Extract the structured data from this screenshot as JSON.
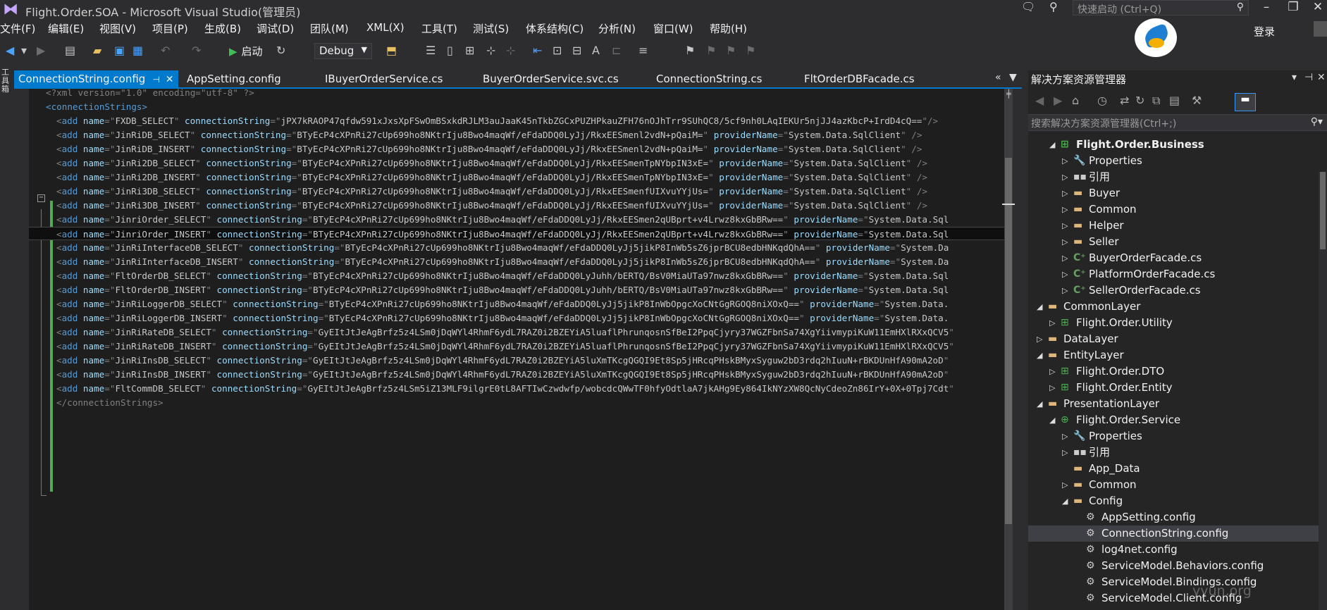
{
  "window": {
    "title": "Flight.Order.SOA - Microsoft Visual Studio(管理员)",
    "quick_launch_placeholder": "快速启动 (Ctrl+Q)",
    "login_label": "登录"
  },
  "menu": [
    "文件(F)",
    "编辑(E)",
    "视图(V)",
    "项目(P)",
    "生成(B)",
    "调试(D)",
    "团队(M)",
    "XML(X)",
    "工具(T)",
    "测试(S)",
    "体系结构(C)",
    "分析(N)",
    "窗口(W)",
    "帮助(H)"
  ],
  "toolbar": {
    "start_label": "启动",
    "configuration": "Debug"
  },
  "left_toolbox_label": "工具箱",
  "tabs": [
    {
      "label": "ConnectionString.config",
      "active": true
    },
    {
      "label": "AppSetting.config",
      "active": false
    },
    {
      "label": "IBuyerOrderService.cs",
      "active": false
    },
    {
      "label": "BuyerOrderService.svc.cs",
      "active": false
    },
    {
      "label": "ConnectionString.cs",
      "active": false
    },
    {
      "label": "FltOrderDBFacade.cs",
      "active": false
    }
  ],
  "editor": {
    "xml_decl": "<?xml version=\"1.0\" encoding=\"utf-8\" ?>",
    "open_tag": "<connectionStrings>",
    "close_tag": "</connectionStrings>",
    "entries": [
      {
        "name": "FXDB_SELECT",
        "conn": "jPX7kRAOP47qfdw591xJxsXpFSwOmBSxkdRJLM3auJaaK45nTkbZGCxPUZHPkauZFH76nOJhTrr9SUhQC8/5cf9nh0LAqIEKUr5njJJ4azKbcP+IrdD4cQ==",
        "provider": ""
      },
      {
        "name": "JinRiDB_SELECT",
        "conn": "BTyEcP4cXPnRi27cUp699ho8NKtrIju8Bwo4maqWf/eFdaDDQ0LyJj/RkxEESmenl2vdN+pQaiM=",
        "provider": "System.Data.SqlClient"
      },
      {
        "name": "JinRiDB_INSERT",
        "conn": "BTyEcP4cXPnRi27cUp699ho8NKtrIju8Bwo4maqWf/eFdaDDQ0LyJj/RkxEESmenl2vdN+pQaiM=",
        "provider": "System.Data.SqlClient"
      },
      {
        "name": "JinRi2DB_SELECT",
        "conn": "BTyEcP4cXPnRi27cUp699ho8NKtrIju8Bwo4maqWf/eFdaDDQ0LyJj/RkxEESmenTpNYbpIN3xE=",
        "provider": "System.Data.SqlClient"
      },
      {
        "name": "JinRi2DB_INSERT",
        "conn": "BTyEcP4cXPnRi27cUp699ho8NKtrIju8Bwo4maqWf/eFdaDDQ0LyJj/RkxEESmenTpNYbpIN3xE=",
        "provider": "System.Data.SqlClient"
      },
      {
        "name": "JinRi3DB_SELECT",
        "conn": "BTyEcP4cXPnRi27cUp699ho8NKtrIju8Bwo4maqWf/eFdaDDQ0LyJj/RkxEESmenfUIXvuYYjUs=",
        "provider": "System.Data.SqlClient"
      },
      {
        "name": "JinRi3DB_INSERT",
        "conn": "BTyEcP4cXPnRi27cUp699ho8NKtrIju8Bwo4maqWf/eFdaDDQ0LyJj/RkxEESmenfUIXvuYYjUs=",
        "provider": "System.Data.SqlClient"
      },
      {
        "name": "JinriOrder_SELECT",
        "conn": "BTyEcP4cXPnRi27cUp699ho8NKtrIju8Bwo4maqWf/eFdaDDQ0LyJj/RkxEESmen2qUBprt+v4Lrwz8kxGbBRw==",
        "provider": "System.Data.Sql"
      },
      {
        "name": "JinriOrder_INSERT",
        "conn": "BTyEcP4cXPnRi27cUp699ho8NKtrIju8Bwo4maqWf/eFdaDDQ0LyJj/RkxEESmen2qUBprt+v4Lrwz8kxGbBRw==",
        "provider": "System.Data.Sql"
      },
      {
        "name": "JinRiInterfaceDB_SELECT",
        "conn": "BTyEcP4cXPnRi27cUp699ho8NKtrIju8Bwo4maqWf/eFdaDDQ0LyJj5jikP8InWb5sZ6jprBCU8edbHNKqdQhA==",
        "provider": "System.Da"
      },
      {
        "name": "JinRiInterfaceDB_INSERT",
        "conn": "BTyEcP4cXPnRi27cUp699ho8NKtrIju8Bwo4maqWf/eFdaDDQ0LyJj5jikP8InWb5sZ6jprBCU8edbHNKqdQhA==",
        "provider": "System.Da"
      },
      {
        "name": "FltOrderDB_SELECT",
        "conn": "BTyEcP4cXPnRi27cUp699ho8NKtrIju8Bwo4maqWf/eFdaDDQ0LyJuhh/bERTQ/BsV0MiaUTa97nwz8kxGbBRw==",
        "provider": "System.Data.Sql"
      },
      {
        "name": "FltOrderDB_INSERT",
        "conn": "BTyEcP4cXPnRi27cUp699ho8NKtrIju8Bwo4maqWf/eFdaDDQ0LyJuhh/bERTQ/BsV0MiaUTa97nwz8kxGbBRw==",
        "provider": "System.Data.Sql"
      },
      {
        "name": "JinRiLoggerDB_SELECT",
        "conn": "BTyEcP4cXPnRi27cUp699ho8NKtrIju8Bwo4maqWf/eFdaDDQ0LyJj5jikP8InWbOpgcXoCNtGgRGOQ8niXOxQ==",
        "provider": "System.Data."
      },
      {
        "name": "JinRiLoggerDB_INSERT",
        "conn": "BTyEcP4cXPnRi27cUp699ho8NKtrIju8Bwo4maqWf/eFdaDDQ0LyJj5jikP8InWbOpgcXoCNtGgRGOQ8niXOxQ==",
        "provider": "System.Data."
      },
      {
        "name": "JinRiRateDB_SELECT",
        "conn": "GyEItJtJeAgBrfz5z4LSm0jDqWYl4RhmF6ydL7RAZ0i2BZEYiA5luaflPhrunqosnSfBeI2PpqCjyry37WGZFbnSa74XgYiivmypiKuW11EmHXlRXxQCV5",
        "provider": ""
      },
      {
        "name": "JinRiRateDB_INSERT",
        "conn": "GyEItJtJeAgBrfz5z4LSm0jDqWYl4RhmF6ydL7RAZ0i2BZEYiA5luaflPhrunqosnSfBeI2PpqCjyry37WGZFbnSa74XgYiivmypiKuW11EmHXlRXxQCV5",
        "provider": ""
      },
      {
        "name": "JinRiInsDB_SELECT",
        "conn": "GyEItJtJeAgBrfz5z4LSm0jDqWYl4RhmF6ydL7RAZ0i2BZEYiA5luXmTKcgQGQI9Et8Sp5jHRcqPHskBMyxSyguw2bD3rdq2hIuuN+rBKDUnHfA90mA2oD",
        "provider": ""
      },
      {
        "name": "JinRiInsDB_INSERT",
        "conn": "GyEItJtJeAgBrfz5z4LSm0jDqWYl4RhmF6ydL7RAZ0i2BZEYiA5luXmTKcgQGQI9Et8Sp5jHRcqPHskBMyxSyguw2bD3rdq2hIuuN+rBKDUnHfA90mA2oD",
        "provider": ""
      },
      {
        "name": "FltCommDB_SELECT",
        "conn": "GyEItJtJeAgBrfz5z4LSm5iZ13MLF9ilgrE0tL8AFTIwCzwdwfp/wobcdcQWwTF0hfyOdtlaA7jkAHg9Ey864IkNYzXW8QcNyCdeoZn86IrY+0X+0Tpj7Cdt",
        "provider": ""
      }
    ]
  },
  "solution_explorer": {
    "title": "解决方案资源管理器",
    "search_placeholder": "搜索解决方案资源管理器(Ctrl+;)",
    "nodes": [
      {
        "label": "Flight.Order.Business",
        "level": 2,
        "icon": "proj",
        "exp": "open",
        "bold": true
      },
      {
        "label": "Properties",
        "level": 3,
        "icon": "wrench",
        "exp": "closed"
      },
      {
        "label": "引用",
        "level": 3,
        "icon": "ref",
        "exp": "closed"
      },
      {
        "label": "Buyer",
        "level": 3,
        "icon": "folder",
        "exp": "closed"
      },
      {
        "label": "Common",
        "level": 3,
        "icon": "folder",
        "exp": "closed"
      },
      {
        "label": "Helper",
        "level": 3,
        "icon": "folder",
        "exp": "closed"
      },
      {
        "label": "Seller",
        "level": 3,
        "icon": "folder",
        "exp": "closed"
      },
      {
        "label": "BuyerOrderFacade.cs",
        "level": 3,
        "icon": "cs",
        "exp": "closed"
      },
      {
        "label": "PlatformOrderFacade.cs",
        "level": 3,
        "icon": "cs",
        "exp": "closed"
      },
      {
        "label": "SellerOrderFacade.cs",
        "level": 3,
        "icon": "cs",
        "exp": "closed"
      },
      {
        "label": "CommonLayer",
        "level": 1,
        "icon": "folder",
        "exp": "open"
      },
      {
        "label": "Flight.Order.Utility",
        "level": 2,
        "icon": "proj",
        "exp": "closed"
      },
      {
        "label": "DataLayer",
        "level": 1,
        "icon": "folder",
        "exp": "closed"
      },
      {
        "label": "EntityLayer",
        "level": 1,
        "icon": "folder",
        "exp": "open"
      },
      {
        "label": "Flight.Order.DTO",
        "level": 2,
        "icon": "proj",
        "exp": "closed"
      },
      {
        "label": "Flight.Order.Entity",
        "level": 2,
        "icon": "proj",
        "exp": "closed"
      },
      {
        "label": "PresentationLayer",
        "level": 1,
        "icon": "folder",
        "exp": "open"
      },
      {
        "label": "Flight.Order.Service",
        "level": 2,
        "icon": "web",
        "exp": "open"
      },
      {
        "label": "Properties",
        "level": 3,
        "icon": "wrench",
        "exp": "closed"
      },
      {
        "label": "引用",
        "level": 3,
        "icon": "ref",
        "exp": "closed"
      },
      {
        "label": "App_Data",
        "level": 3,
        "icon": "folder",
        "exp": "none"
      },
      {
        "label": "Common",
        "level": 3,
        "icon": "folder",
        "exp": "closed"
      },
      {
        "label": "Config",
        "level": 3,
        "icon": "folder",
        "exp": "open"
      },
      {
        "label": "AppSetting.config",
        "level": 4,
        "icon": "config",
        "exp": "none"
      },
      {
        "label": "ConnectionString.config",
        "level": 4,
        "icon": "config",
        "exp": "none",
        "selected": true
      },
      {
        "label": "log4net.config",
        "level": 4,
        "icon": "config",
        "exp": "none"
      },
      {
        "label": "ServiceModel.Behaviors.config",
        "level": 4,
        "icon": "config",
        "exp": "none"
      },
      {
        "label": "ServiceModel.Bindings.config",
        "level": 4,
        "icon": "config",
        "exp": "none"
      },
      {
        "label": "ServiceModel.Client.config",
        "level": 4,
        "icon": "config",
        "exp": "none"
      }
    ]
  },
  "watermark": "yyun.org"
}
